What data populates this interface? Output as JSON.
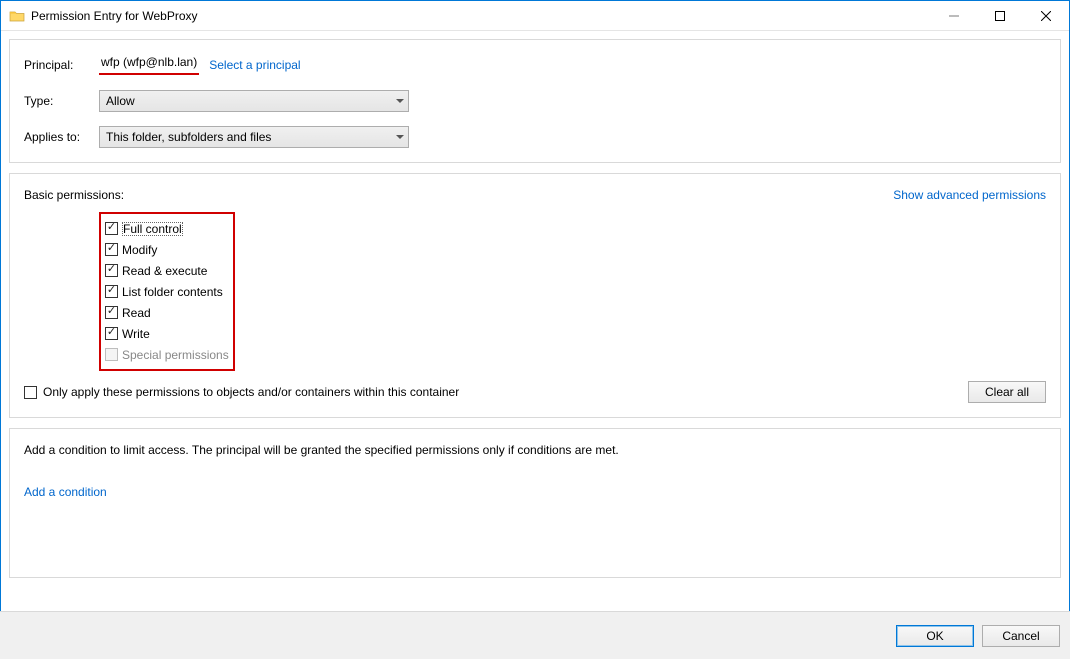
{
  "window": {
    "title": "Permission Entry for WebProxy"
  },
  "labels": {
    "principal": "Principal:",
    "type": "Type:",
    "applies_to": "Applies to:",
    "basic_permissions": "Basic permissions:",
    "show_advanced": "Show advanced permissions",
    "only_apply": "Only apply these permissions to objects and/or containers within this container",
    "clear_all": "Clear all",
    "condition_text": "Add a condition to limit access. The principal will be granted the specified permissions only if conditions are met.",
    "add_condition": "Add a condition",
    "ok": "OK",
    "cancel": "Cancel",
    "select_principal": "Select a principal"
  },
  "principal": "wfp (wfp@nlb.lan)",
  "type_value": "Allow",
  "applies_value": "This folder, subfolders and files",
  "permissions": {
    "full_control": "Full control",
    "modify": "Modify",
    "read_execute": "Read & execute",
    "list_folder": "List folder contents",
    "read": "Read",
    "write": "Write",
    "special": "Special permissions"
  }
}
